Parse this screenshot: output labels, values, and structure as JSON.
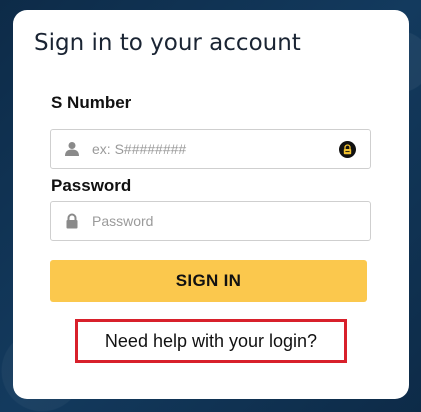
{
  "card": {
    "title": "Sign in to your account"
  },
  "s_number": {
    "label": "S Number",
    "placeholder": "ex: S########",
    "value": ""
  },
  "password": {
    "label": "Password",
    "placeholder": "Password",
    "value": ""
  },
  "actions": {
    "sign_in_label": "SIGN IN",
    "help_label": "Need help with your login?"
  },
  "icons": {
    "user": "user-icon",
    "lock": "lock-icon",
    "autofill": "password-manager-icon"
  },
  "colors": {
    "background": "#0f2f4f",
    "card": "#ffffff",
    "accent": "#fbc84d",
    "highlight_border": "#d8202b"
  }
}
